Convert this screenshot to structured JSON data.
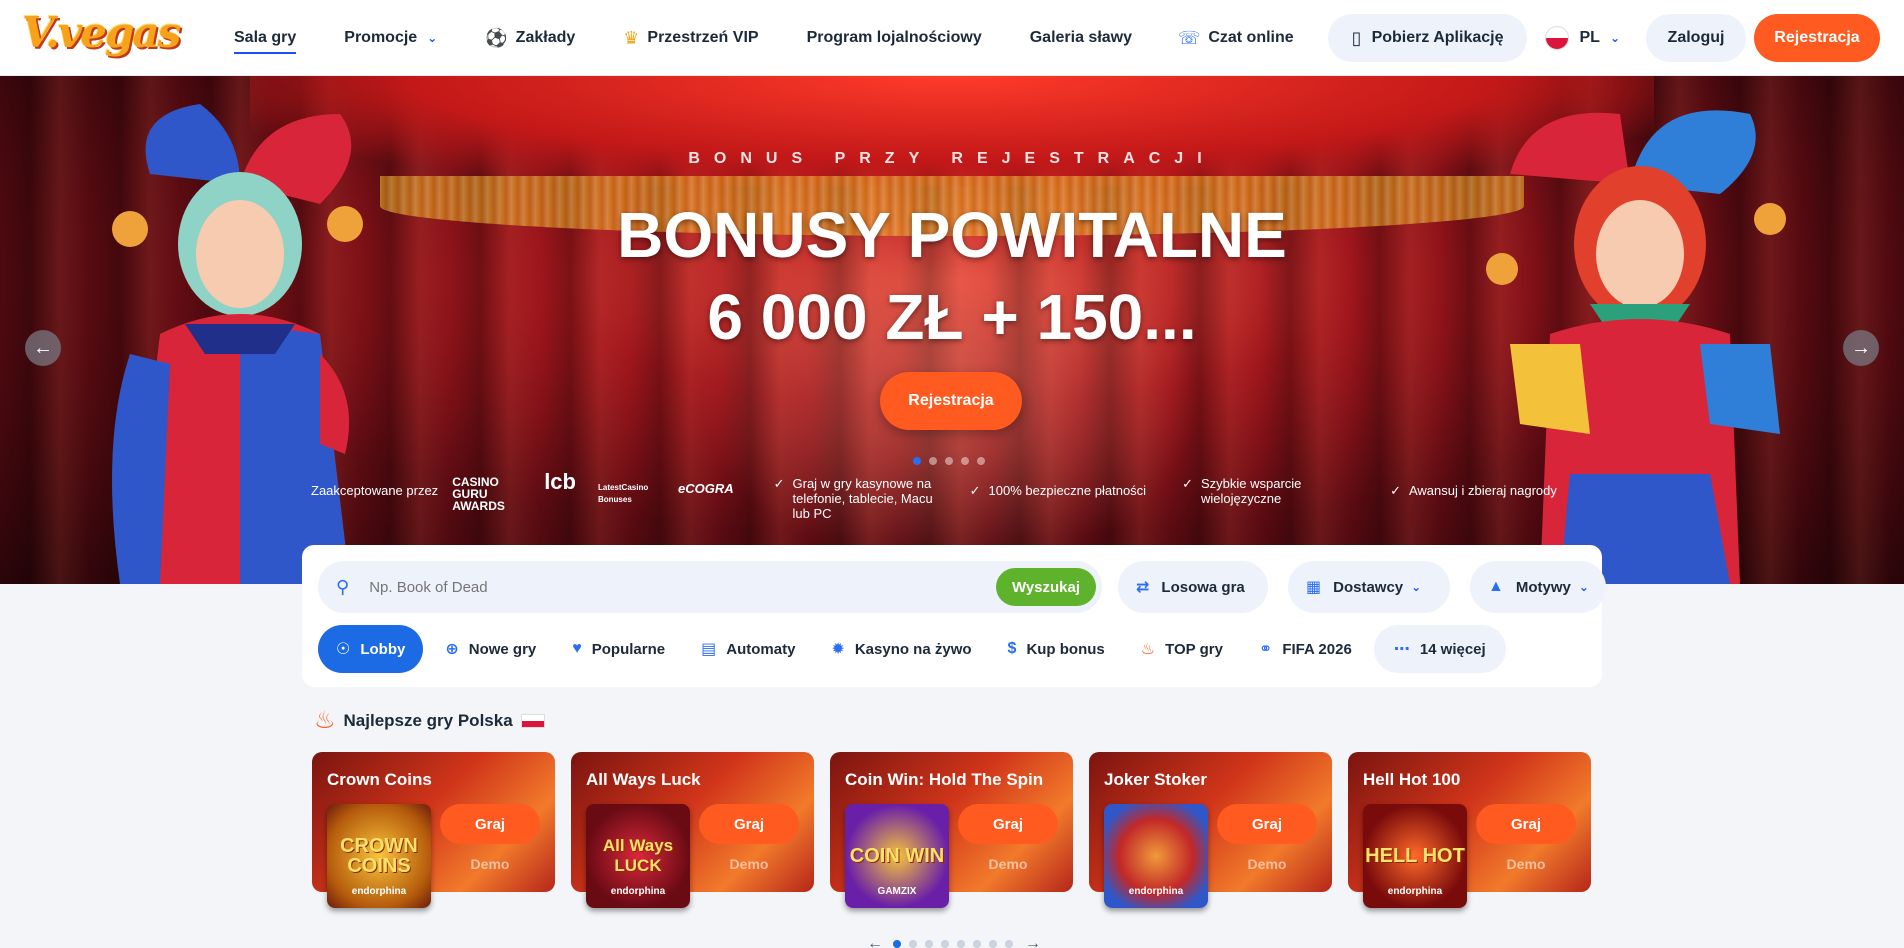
{
  "logo_text": "V.vegas",
  "nav": [
    {
      "label": "Sala gry",
      "icon": "",
      "active": true,
      "dropdown": false
    },
    {
      "label": "Promocje",
      "icon": "",
      "active": false,
      "dropdown": true
    },
    {
      "label": "Zakłady",
      "icon": "soccer-ball-icon",
      "active": false,
      "dropdown": false
    },
    {
      "label": "Przestrzeń VIP",
      "icon": "crown-icon",
      "active": false,
      "dropdown": false
    },
    {
      "label": "Program lojalnościowy",
      "icon": "",
      "active": false,
      "dropdown": false
    },
    {
      "label": "Galeria sławy",
      "icon": "",
      "active": false,
      "dropdown": false
    }
  ],
  "header": {
    "chat_label": "Czat online",
    "app_label": "Pobierz Aplikację",
    "lang_label": "PL",
    "login_label": "Zaloguj",
    "register_label": "Rejestracja"
  },
  "hero": {
    "subtitle": "BONUS PRZY REJESTRACJI",
    "title_line1": "BONUSY POWITALNE",
    "title_line2": "6 000 ZŁ + 150...",
    "cta_label": "Rejestracja",
    "slides_total": 5,
    "active_slide": 1,
    "accepted_label": "Zaakceptowane przez",
    "partner_logos": [
      "CASINO GURU AWARDS",
      "lcb",
      "LatestCasino Bonuses",
      "eCOGRA"
    ],
    "features": [
      "Graj w gry kasynowe na telefonie, tablecie, Macu lub PC",
      "100% bezpieczne płatności",
      "Szybkie wsparcie wielojęzyczne",
      "Awansuj i zbieraj nagrody"
    ]
  },
  "search": {
    "placeholder": "Np. Book of Dead",
    "button_label": "Wyszukaj",
    "random_label": "Losowa gra",
    "providers_label": "Dostawcy",
    "themes_label": "Motywy"
  },
  "categories": [
    {
      "label": "Lobby",
      "icon": "medal-icon",
      "active": true
    },
    {
      "label": "Nowe gry",
      "icon": "plus-circle-icon",
      "active": false
    },
    {
      "label": "Popularne",
      "icon": "heart-icon",
      "active": false
    },
    {
      "label": "Automaty",
      "icon": "slot-machine-icon",
      "active": false
    },
    {
      "label": "Kasyno na żywo",
      "icon": "live-casino-icon",
      "active": false
    },
    {
      "label": "Kup bonus",
      "icon": "dollar-icon",
      "active": false
    },
    {
      "label": "TOP gry",
      "icon": "fire-icon",
      "active": false
    },
    {
      "label": "FIFA 2026",
      "icon": "trophy-icon",
      "active": false
    },
    {
      "label": "14 więcej",
      "icon": "more-dots-icon",
      "active": false
    }
  ],
  "top_games": {
    "title": "Najlepsze gry Polska",
    "play_label": "Graj",
    "demo_label": "Demo",
    "games": [
      {
        "title": "Crown Coins",
        "thumb_text": "CROWN COINS",
        "provider": "endorphina"
      },
      {
        "title": "All Ways Luck",
        "thumb_text": "All Ways LUCK",
        "provider": "endorphina"
      },
      {
        "title": "Coin Win: Hold The Spin",
        "thumb_text": "COIN WIN",
        "provider": "GAMZIX"
      },
      {
        "title": "Joker Stoker",
        "thumb_text": "",
        "provider": "endorphina"
      },
      {
        "title": "Hell Hot 100",
        "thumb_text": "HELL HOT",
        "provider": "endorphina"
      }
    ],
    "pages_total": 8,
    "active_page": 1
  },
  "colors": {
    "accent_orange": "#ff5a1f",
    "accent_blue": "#1d6ae5",
    "search_green": "#5fb32c"
  }
}
